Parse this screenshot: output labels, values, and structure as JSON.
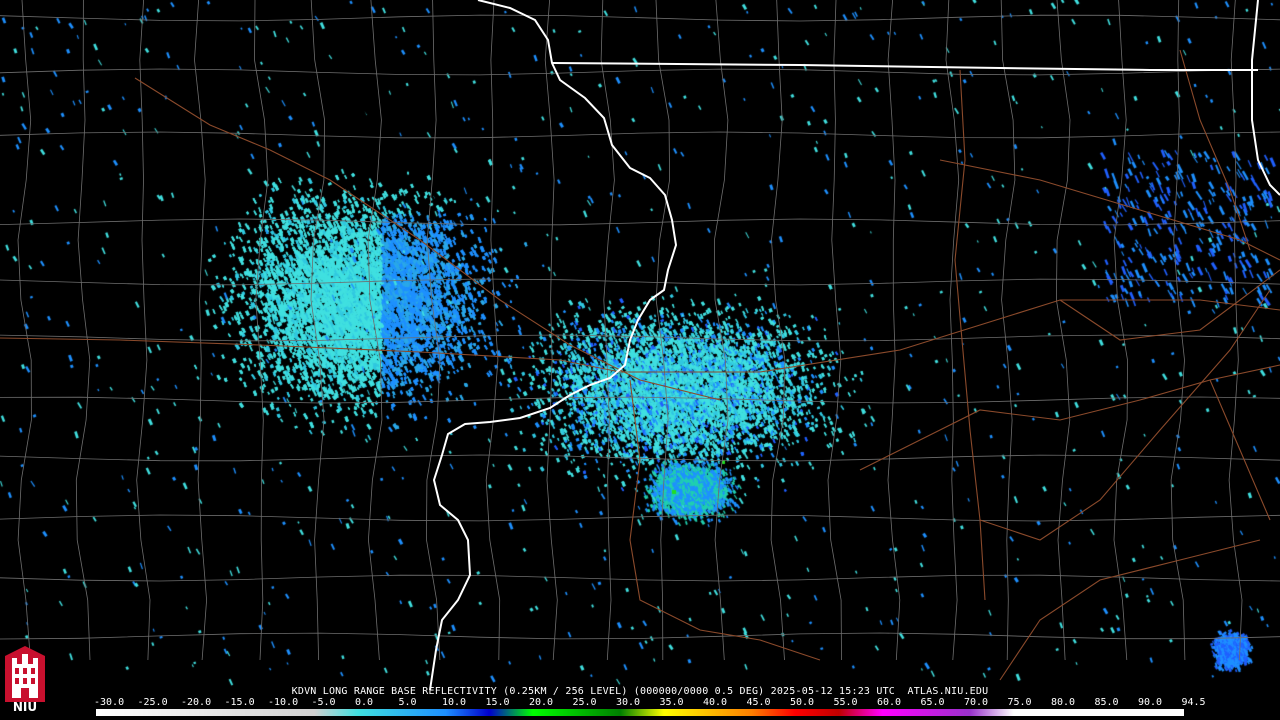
{
  "product": {
    "caption": "KDVN LONG RANGE BASE REFLECTIVITY (0.25KM / 256 LEVEL) (000000/0000 0.5 DEG) 2025-05-12 15:23 UTC  ATLAS.NIU.EDU"
  },
  "legend": {
    "ticks": [
      "-30.0",
      "-25.0",
      "-20.0",
      "-15.0",
      "-10.0",
      "-5.0",
      "0.0",
      "5.0",
      "10.0",
      "15.0",
      "20.0",
      "25.0",
      "30.0",
      "35.0",
      "40.0",
      "45.0",
      "50.0",
      "55.0",
      "60.0",
      "65.0",
      "70.0",
      "75.0",
      "80.0",
      "85.0",
      "90.0",
      "94.5"
    ],
    "range": [
      -30.0,
      94.5
    ],
    "colors": [
      {
        "dbz": -30,
        "color": "#ffffff"
      },
      {
        "dbz": -5,
        "color": "#d0d0d0"
      },
      {
        "dbz": 0,
        "color": "#40e0e0"
      },
      {
        "dbz": 10,
        "color": "#1e90ff"
      },
      {
        "dbz": 15,
        "color": "#0000cd"
      },
      {
        "dbz": 20,
        "color": "#00ff00"
      },
      {
        "dbz": 30,
        "color": "#008000"
      },
      {
        "dbz": 35,
        "color": "#ffff00"
      },
      {
        "dbz": 40,
        "color": "#ffc000"
      },
      {
        "dbz": 45,
        "color": "#ff8000"
      },
      {
        "dbz": 50,
        "color": "#ff0000"
      },
      {
        "dbz": 55,
        "color": "#c00000"
      },
      {
        "dbz": 60,
        "color": "#ff00ff"
      },
      {
        "dbz": 70,
        "color": "#9932cc"
      },
      {
        "dbz": 75,
        "color": "#ffffff"
      },
      {
        "dbz": 94.5,
        "color": "#ffffff"
      }
    ]
  },
  "logo": {
    "text": "NIU",
    "color": "#c8102e"
  },
  "map": {
    "background": "#000000",
    "county_line_color": "#6e6e6e",
    "state_line_color": "#ffffff",
    "highway_color": "#8b4a2b",
    "echo_colors": [
      "#40e0e0",
      "#30c8e0",
      "#2aa8e8",
      "#1e90ff",
      "#2060ff",
      "#20d0b0"
    ]
  }
}
